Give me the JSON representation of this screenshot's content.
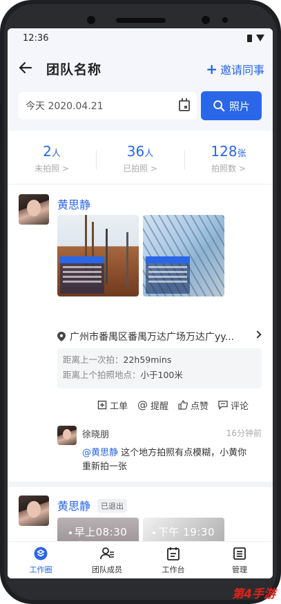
{
  "status": {
    "time": "12:36"
  },
  "header": {
    "title": "团队名称",
    "invite_label": "邀请同事"
  },
  "search": {
    "date_value": "今天  2020.04.21",
    "photo_button": "照片"
  },
  "stats": [
    {
      "num": "2",
      "unit": "人",
      "label": "未拍照 >"
    },
    {
      "num": "36",
      "unit": "人",
      "label": "已拍照 >"
    },
    {
      "num": "128",
      "unit": "张",
      "label": "拍照数 >"
    }
  ],
  "posts": [
    {
      "name": "黄思静",
      "location": "广州市番禺区番禺万达广场万达广yy...",
      "info_last_label": "距离上一次拍：",
      "info_last_value": "22h59mins",
      "info_dist_label": "距离上个拍照地点：",
      "info_dist_value": "小于100米",
      "actions": [
        "工单",
        "提醒",
        "点赞",
        "评论"
      ],
      "comment": {
        "name": "徐晓朋",
        "time": "16分钟前",
        "mention": "@黄思静",
        "text": " 这个地方拍照有点模糊，小黄你重新拍一张"
      }
    },
    {
      "name": "黄思静",
      "badge": "已退出",
      "photo_times": [
        "早上08:30",
        "下午 19:30"
      ]
    }
  ],
  "tabs": [
    {
      "label": "工作圈",
      "icon": "work-circle-icon",
      "active": true
    },
    {
      "label": "团队成员",
      "icon": "team-members-icon",
      "active": false
    },
    {
      "label": "工作台",
      "icon": "workbench-icon",
      "active": false
    },
    {
      "label": "管理",
      "icon": "management-icon",
      "active": false
    }
  ],
  "watermark": "第4手游",
  "colors": {
    "accent": "#2a66e8",
    "background": "#f4f6fb"
  }
}
